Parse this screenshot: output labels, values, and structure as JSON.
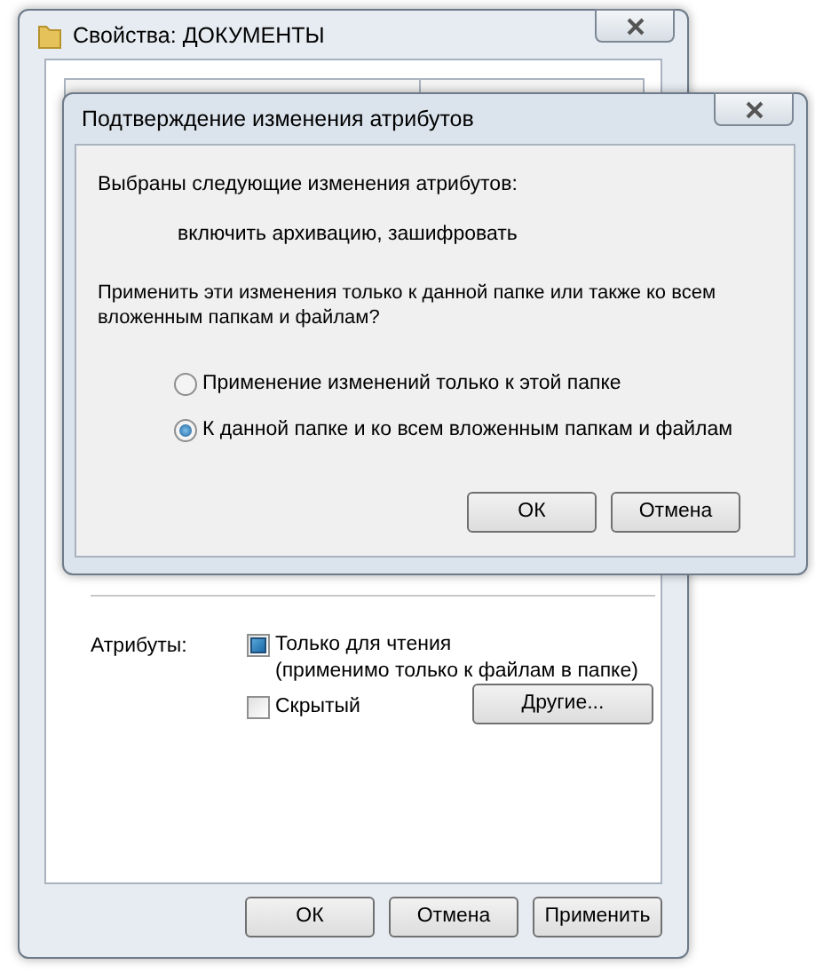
{
  "properties_window": {
    "title": "Свойства: ДОКУМЕНТЫ",
    "attributes": {
      "label": "Атрибуты:",
      "checkboxes": [
        {
          "label": "Только для чтения",
          "note": "(применимо только к файлам в папке)",
          "checked": true
        },
        {
          "label": "Скрытый",
          "checked": false
        }
      ],
      "other_button": "Другие..."
    },
    "buttons": [
      "ОК",
      "Отмена",
      "Применить"
    ]
  },
  "confirm_dialog": {
    "title": "Подтверждение изменения атрибутов",
    "message": "Выбраны следующие изменения атрибутов:",
    "changes": "включить архивацию, зашифровать",
    "question": "Применить эти изменения только к данной папке или также ко всем вложенным папкам и файлам?",
    "options": [
      {
        "label": "Применение изменений только к этой папке",
        "selected": false
      },
      {
        "label": "К данной папке и ко всем вложенным папкам и файлам",
        "selected": true
      }
    ],
    "buttons": [
      "ОК",
      "Отмена"
    ]
  }
}
